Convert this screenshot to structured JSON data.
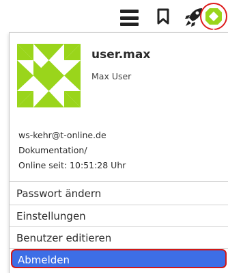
{
  "toolbar": {
    "icons": [
      "menu-icon",
      "bookmark-icon",
      "rocket-icon",
      "user-avatar-icon"
    ],
    "highlight_color": "#dd1b1b"
  },
  "user": {
    "username": "user.max",
    "full_name": "Max User",
    "email": "ws-kehr@t-online.de",
    "path": "Dokumentation/",
    "online_since": "Online seit: 10:51:28 Uhr",
    "avatar_color": "#9ad51b"
  },
  "menu": {
    "change_password": "Passwort ändern",
    "settings": "Einstellungen",
    "edit_user": "Benutzer editieren",
    "logout": "Abmelden",
    "logout_bg": "#3d6ee6"
  }
}
